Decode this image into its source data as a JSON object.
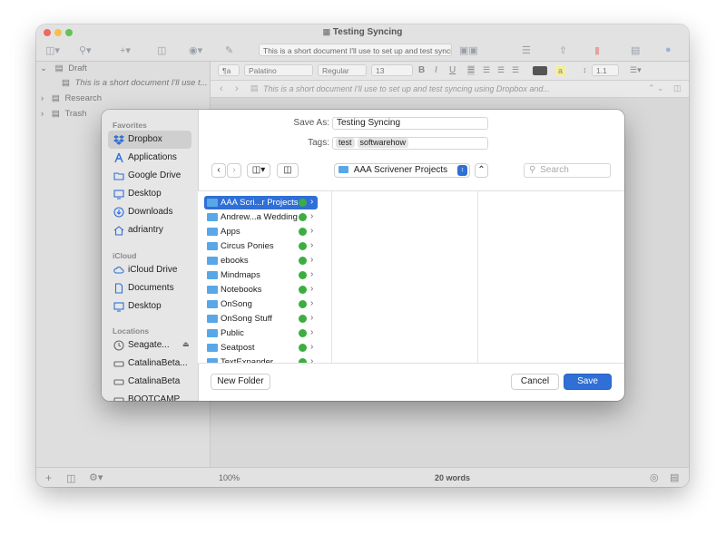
{
  "window": {
    "title": "Testing Syncing",
    "search_text": "This is a short document I'll use to set up and test synci...",
    "traffic": [
      "#ed6a5e",
      "#f5bf4f",
      "#61c554"
    ]
  },
  "binder": {
    "items": [
      {
        "label": "Draft"
      },
      {
        "label": "This is a short document I'll use t..."
      },
      {
        "label": "Research"
      },
      {
        "label": "Trash"
      }
    ]
  },
  "editor": {
    "style_btn": "¶a",
    "font": "Palatino",
    "weight": "Regular",
    "size": "13",
    "bold": "B",
    "italic": "I",
    "underline": "U",
    "highlight": "a",
    "spacing": "1.1",
    "header_text": "This is a short document I'll use to set up and test syncing using Dropbox and..."
  },
  "footer": {
    "zoom": "100%",
    "word_count": "20 words"
  },
  "dialog": {
    "save_as_label": "Save As:",
    "save_as_value": "Testing Syncing",
    "tags_label": "Tags:",
    "tags": [
      "test",
      "softwarehow"
    ],
    "location": "AAA Scrivener Projects",
    "search_placeholder": "Search",
    "new_folder": "New Folder",
    "cancel": "Cancel",
    "save": "Save",
    "accent": "#2f6fd6",
    "sections": {
      "favorites": "Favorites",
      "icloud": "iCloud",
      "locations": "Locations"
    },
    "favorites": [
      {
        "label": "Dropbox",
        "icon": "dropbox-icon"
      },
      {
        "label": "Applications",
        "icon": "applications-icon"
      },
      {
        "label": "Google Drive",
        "icon": "folder-icon"
      },
      {
        "label": "Desktop",
        "icon": "desktop-icon"
      },
      {
        "label": "Downloads",
        "icon": "downloads-icon"
      },
      {
        "label": "adriantry",
        "icon": "home-icon"
      }
    ],
    "icloud_items": [
      {
        "label": "iCloud Drive",
        "icon": "cloud-icon"
      },
      {
        "label": "Documents",
        "icon": "document-icon"
      },
      {
        "label": "Desktop",
        "icon": "desktop-icon"
      }
    ],
    "locations_items": [
      {
        "label": "Seagate...",
        "icon": "clock-icon"
      },
      {
        "label": "CatalinaBeta...",
        "icon": "disk-icon"
      },
      {
        "label": "CatalinaBeta",
        "icon": "disk-icon"
      },
      {
        "label": "BOOTCAMP",
        "icon": "disk-icon"
      }
    ],
    "folders": [
      {
        "label": "AAA Scri...r Projects"
      },
      {
        "label": "Andrew...a Wedding"
      },
      {
        "label": "Apps"
      },
      {
        "label": "Circus Ponies"
      },
      {
        "label": "ebooks"
      },
      {
        "label": "Mindmaps"
      },
      {
        "label": "Notebooks"
      },
      {
        "label": "OnSong"
      },
      {
        "label": "OnSong Stuff"
      },
      {
        "label": "Public"
      },
      {
        "label": "Seatpost"
      },
      {
        "label": "TextExpander"
      }
    ]
  }
}
